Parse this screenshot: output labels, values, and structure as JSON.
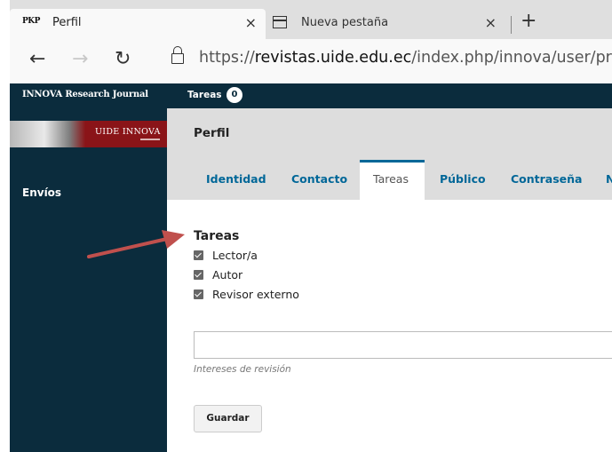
{
  "browser": {
    "tabs": [
      {
        "favicon_text": "PKP",
        "title": "Perfil",
        "close": "×"
      },
      {
        "title": "Nueva pestaña",
        "close": "×"
      }
    ],
    "new_tab": "+",
    "url_prefix": "https://",
    "url_host": "revistas.uide.edu.ec",
    "url_path": "/index.php/innova/user/profil"
  },
  "app": {
    "brand": "INNOVA Research Journal",
    "tasks_label": "Tareas",
    "tasks_count": "0",
    "logo_text": "UIDE INNOVA"
  },
  "sidebar": {
    "items": [
      {
        "label": "Envíos"
      }
    ]
  },
  "main": {
    "page_title": "Perfil",
    "tabs": [
      {
        "label": "Identidad"
      },
      {
        "label": "Contacto"
      },
      {
        "label": "Tareas"
      },
      {
        "label": "Público"
      },
      {
        "label": "Contraseña"
      },
      {
        "label": "N"
      }
    ],
    "active_tab": "Tareas",
    "roles_section": {
      "title": "Tareas",
      "roles": [
        {
          "label": "Lector/a",
          "checked": true
        },
        {
          "label": "Autor",
          "checked": true
        },
        {
          "label": "Revisor externo",
          "checked": true
        }
      ]
    },
    "interests": {
      "value": "",
      "label": "Intereses de revisión"
    },
    "save_label": "Guardar"
  },
  "colors": {
    "header_bg": "#0b2c3d",
    "link_blue": "#006798",
    "annotation_arrow": "#c0504d"
  }
}
